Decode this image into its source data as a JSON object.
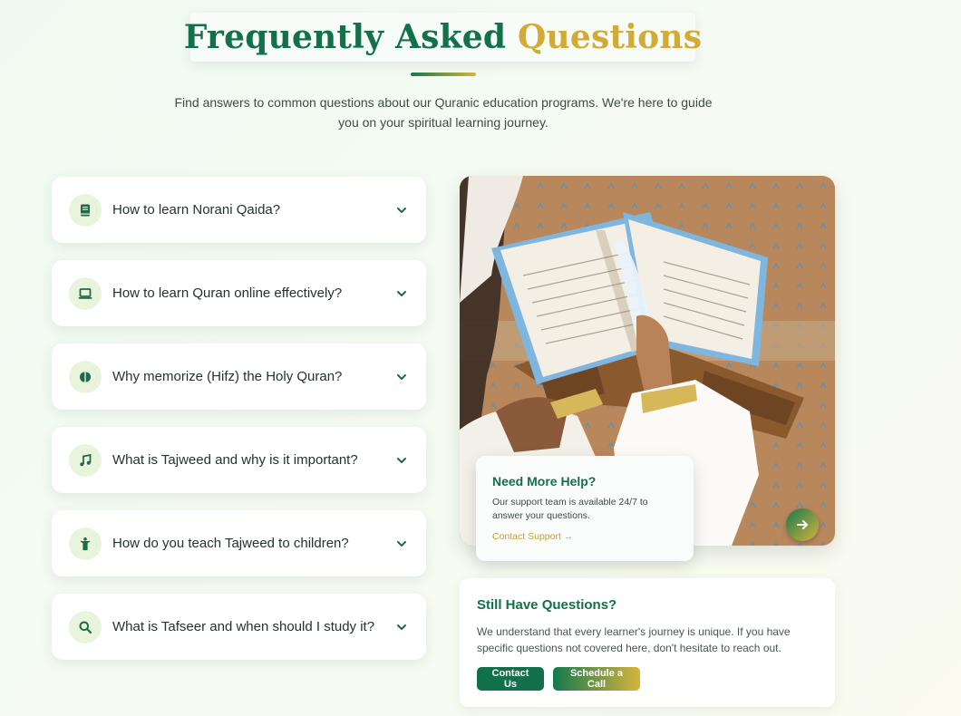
{
  "header": {
    "title_main": "Frequently Asked",
    "title_accent": "Questions",
    "subtitle": "Find answers to common questions about our Quranic education programs. We're here to guide you on your spiritual learning journey."
  },
  "faqs": [
    {
      "question": "How to learn Norani Qaida?",
      "icon": "book-icon"
    },
    {
      "question": "How to learn Quran online effectively?",
      "icon": "laptop-icon"
    },
    {
      "question": "Why memorize (Hifz) the Holy Quran?",
      "icon": "brain-icon"
    },
    {
      "question": "What is Tajweed and why is it important?",
      "icon": "music-note-icon"
    },
    {
      "question": "How do you teach Tajweed to children?",
      "icon": "child-icon"
    },
    {
      "question": "What is Tafseer and when should I study it?",
      "icon": "search-icon"
    }
  ],
  "help_card": {
    "title": "Need More Help?",
    "text": "Our support team is available 24/7 to answer your questions.",
    "link": "Contact Support →"
  },
  "still_questions": {
    "title": "Still Have Questions?",
    "text": "We understand that every learner's journey is unique. If you have specific questions not covered here, don't hesitate to reach out.",
    "contact_label": "Contact Us",
    "schedule_label": "Schedule a Call"
  },
  "colors": {
    "primary": "#12704a",
    "accent": "#d2ab35",
    "icon_bg": "#e8f5dc"
  }
}
